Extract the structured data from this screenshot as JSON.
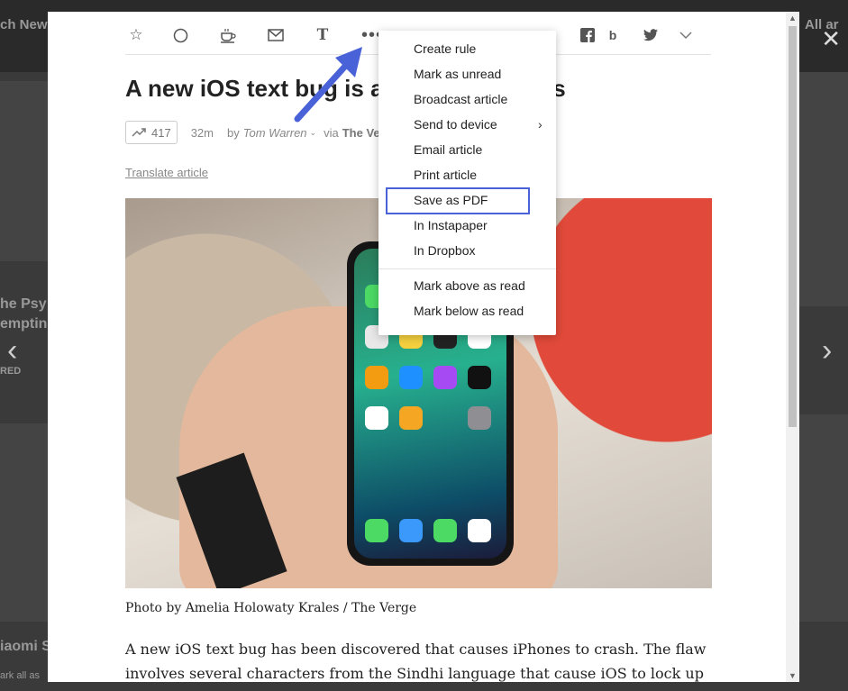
{
  "background": {
    "labels": [
      "ch News",
      "All ar",
      "he Psy",
      "emptin",
      "RED",
      "iaomi S",
      "ark all as"
    ]
  },
  "toolbar": {
    "icons": [
      "star-icon",
      "circle-icon",
      "coffee-icon",
      "mail-icon",
      "text-icon",
      "more-icon",
      "facebook-icon",
      "buffer-icon",
      "twitter-icon",
      "chevron-down-icon"
    ]
  },
  "article": {
    "title": "A new iOS text bug is affecting iPhones",
    "trend_count": "417",
    "age": "32m",
    "by_prefix": "by",
    "author": "Tom Warren",
    "via_prefix": "via",
    "source": "The Verge",
    "translate_label": "Translate article",
    "photo_caption": "Photo by Amelia Holowaty Krales / The Verge",
    "body": "A new iOS text bug has been discovered that causes iPhones to crash. The flaw involves several characters from the Sindhi language that cause iOS to lock up and"
  },
  "menu": {
    "items": [
      "Create rule",
      "Mark as unread",
      "Broadcast article",
      "Send to device",
      "Email article",
      "Print article",
      "Save as PDF",
      "In Instapaper",
      "In Dropbox"
    ],
    "items2": [
      "Mark above as read",
      "Mark below as read"
    ],
    "highlighted": "Save as PDF",
    "highlight_color": "#4a62d8"
  }
}
